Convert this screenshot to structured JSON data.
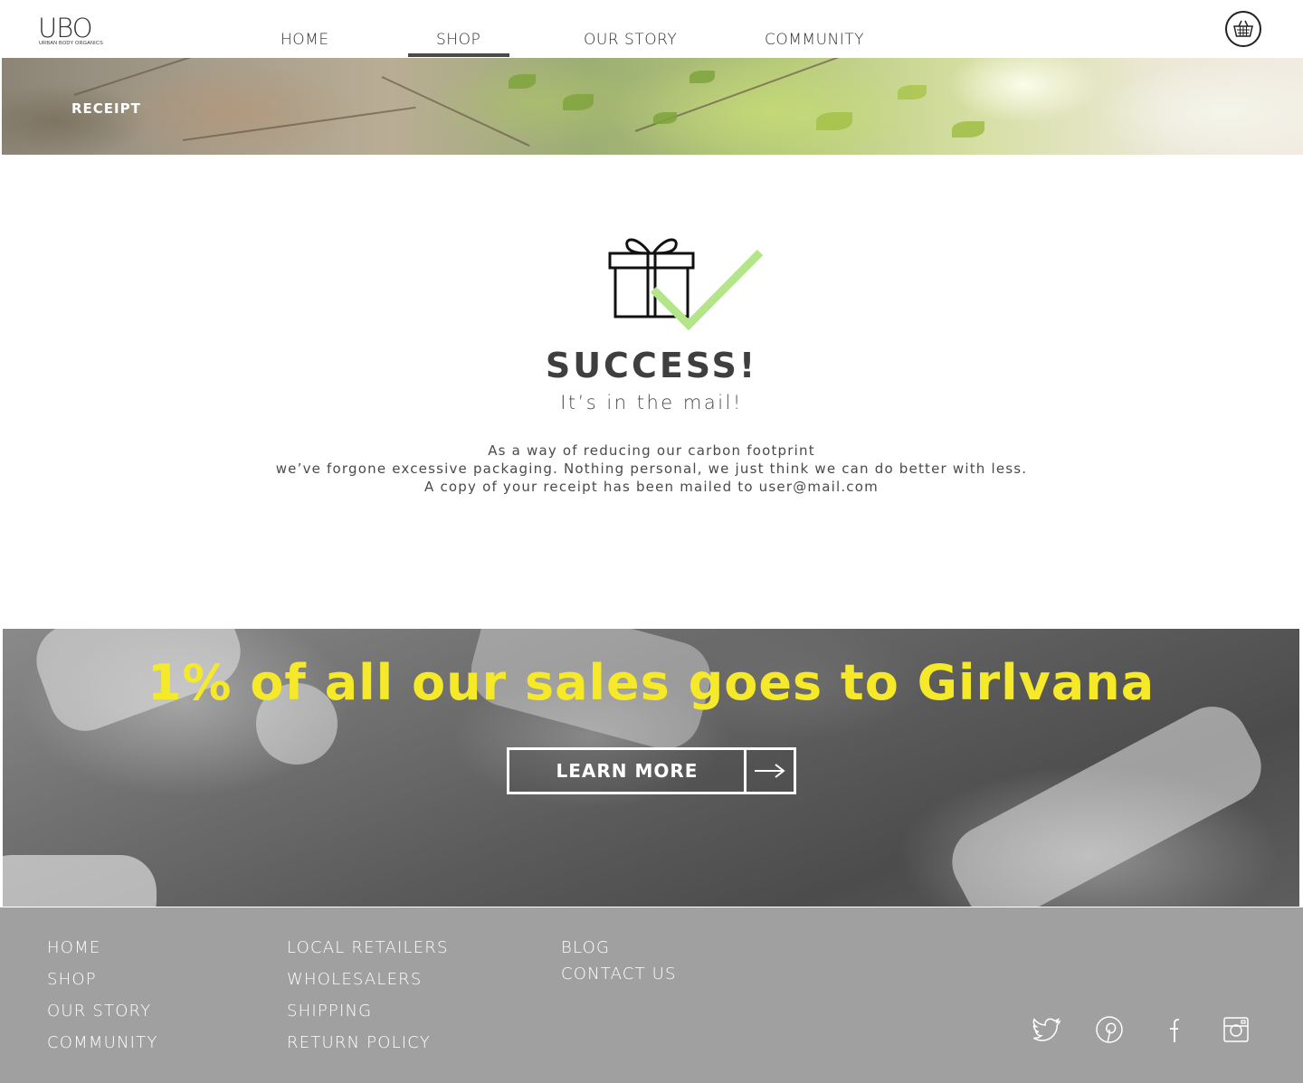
{
  "header": {
    "logo_text": "UBO",
    "logo_subtext": "URBAN BODY ORGANICS",
    "nav": [
      {
        "label": "HOME"
      },
      {
        "label": "SHOP"
      },
      {
        "label": "OUR STORY"
      },
      {
        "label": "COMMUNITY"
      }
    ],
    "active_nav": "SHOP",
    "cart_icon": "basket-icon"
  },
  "banner": {
    "title": "RECEIPT"
  },
  "success": {
    "icon": "gift-check-icon",
    "title": "SUCCESS!",
    "subtitle": "It’s in the mail!",
    "message_lines": [
      "As a way of reducing our carbon footprint",
      "we’ve forgone excessive packaging. Nothing personal, we just think we can do better with less.",
      "A copy of your receipt has been mailed to user@mail.com"
    ]
  },
  "promo": {
    "title": "1% of all our sales goes to Girlvana",
    "button_label": "LEARN MORE",
    "button_icon": "arrow-right-icon"
  },
  "footer": {
    "col1": [
      "HOME",
      "SHOP",
      "OUR STORY",
      "COMMUNITY"
    ],
    "col2": [
      "LOCAL RETAILERS",
      "WHOLESALERS",
      "SHIPPING",
      "RETURN POLICY"
    ],
    "col3": [
      "BLOG",
      "CONTACT US"
    ],
    "social": [
      "twitter-icon",
      "pinterest-icon",
      "facebook-icon",
      "instagram-icon"
    ]
  },
  "colors": {
    "accent_yellow": "#f5e92a",
    "check_green": "#b5e58a",
    "footer_bg": "#a0a0a0",
    "text_dark": "#3f3f3f"
  }
}
